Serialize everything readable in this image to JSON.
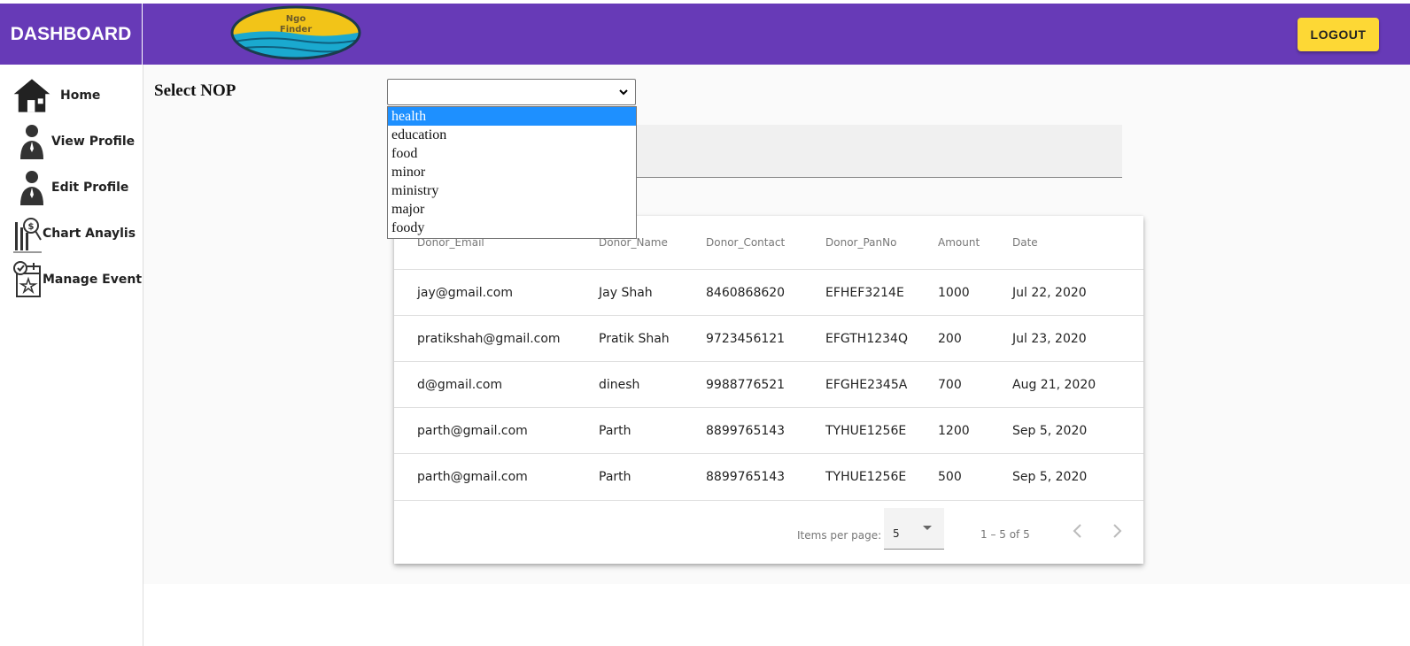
{
  "header": {
    "title": "DASHBOARD",
    "logo_text_line1": "Ngo",
    "logo_text_line2": "Finder",
    "logout_label": "LOGOUT"
  },
  "sidebar": {
    "items": [
      {
        "label": "Home",
        "icon": "home-icon"
      },
      {
        "label": "View Profile",
        "icon": "person-icon"
      },
      {
        "label": "Edit Profile",
        "icon": "person-icon"
      },
      {
        "label": "Chart Anaylis",
        "icon": "chart-analysis-icon"
      },
      {
        "label": "Manage Event",
        "icon": "calendar-event-icon"
      }
    ]
  },
  "nop": {
    "label": "Select NOP",
    "selected": "",
    "options": [
      "health",
      "education",
      "food",
      "minor",
      "ministry",
      "major",
      "foody"
    ],
    "highlighted": "health"
  },
  "table": {
    "headers": [
      "Donor_Email",
      "Donor_Name",
      "Donor_Contact",
      "Donor_PanNo",
      "Amount",
      "Date"
    ],
    "rows": [
      [
        "jay@gmail.com",
        "Jay Shah",
        "8460868620",
        "EFHEF3214E",
        "1000",
        "Jul 22, 2020"
      ],
      [
        "pratikshah@gmail.com",
        "Pratik Shah",
        "9723456121",
        "EFGTH1234Q",
        "200",
        "Jul 23, 2020"
      ],
      [
        "d@gmail.com",
        "dinesh",
        "9988776521",
        "EFGHE2345A",
        "700",
        "Aug 21, 2020"
      ],
      [
        "parth@gmail.com",
        "Parth",
        "8899765143",
        "TYHUE1256E",
        "1200",
        "Sep 5, 2020"
      ],
      [
        "parth@gmail.com",
        "Parth",
        "8899765143",
        "TYHUE1256E",
        "500",
        "Sep 5, 2020"
      ]
    ]
  },
  "paginator": {
    "items_per_page_label": "Items per page:",
    "items_per_page": "5",
    "range_label": "1 – 5 of 5"
  },
  "colors": {
    "header": "#673ab7",
    "logout": "#fdd835",
    "option_highlight": "#1e90ff"
  }
}
